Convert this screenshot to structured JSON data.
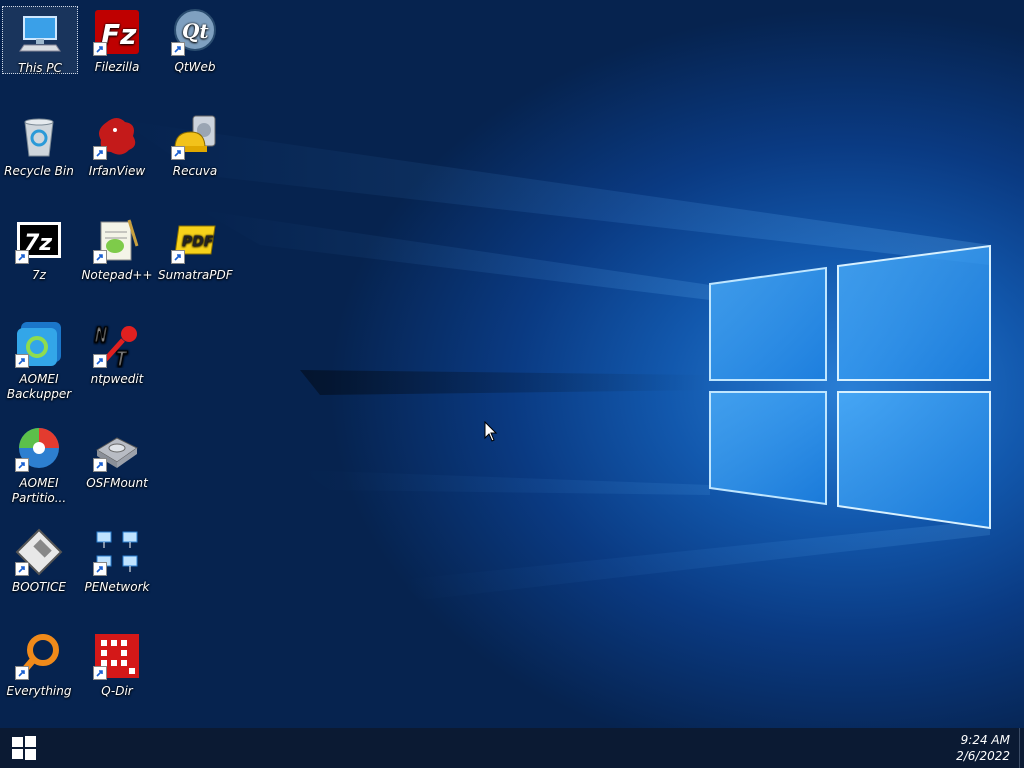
{
  "desktop": {
    "icons": [
      {
        "label": "This PC",
        "icon": "this-pc-icon"
      },
      {
        "label": "Filezilla",
        "icon": "filezilla-icon"
      },
      {
        "label": "QtWeb",
        "icon": "qtweb-icon"
      },
      {
        "label": "Recycle Bin",
        "icon": "recycle-bin-icon"
      },
      {
        "label": "IrfanView",
        "icon": "irfanview-icon"
      },
      {
        "label": "Recuva",
        "icon": "recuva-icon"
      },
      {
        "label": "7z",
        "icon": "7zip-icon"
      },
      {
        "label": "Notepad++",
        "icon": "notepad-plus-plus-icon"
      },
      {
        "label": "SumatraPDF",
        "icon": "sumatrapdf-icon"
      },
      {
        "label": "AOMEI Backupper",
        "icon": "aomei-backupper-icon"
      },
      {
        "label": "ntpwedit",
        "icon": "ntpwedit-icon"
      },
      {
        "label": "AOMEI Partitio...",
        "icon": "aomei-partition-icon"
      },
      {
        "label": "OSFMount",
        "icon": "osfmount-icon"
      },
      {
        "label": "BOOTICE",
        "icon": "bootice-icon"
      },
      {
        "label": "PENetwork",
        "icon": "penetwork-icon"
      },
      {
        "label": "Everything",
        "icon": "everything-icon"
      },
      {
        "label": "Q-Dir",
        "icon": "qdir-icon"
      }
    ]
  },
  "taskbar": {
    "time": "9:24 AM",
    "date": "2/6/2022",
    "start_icon": "windows-start-icon"
  },
  "colors": {
    "accent": "#1e6fd0",
    "taskbar": "#0b1a33"
  }
}
